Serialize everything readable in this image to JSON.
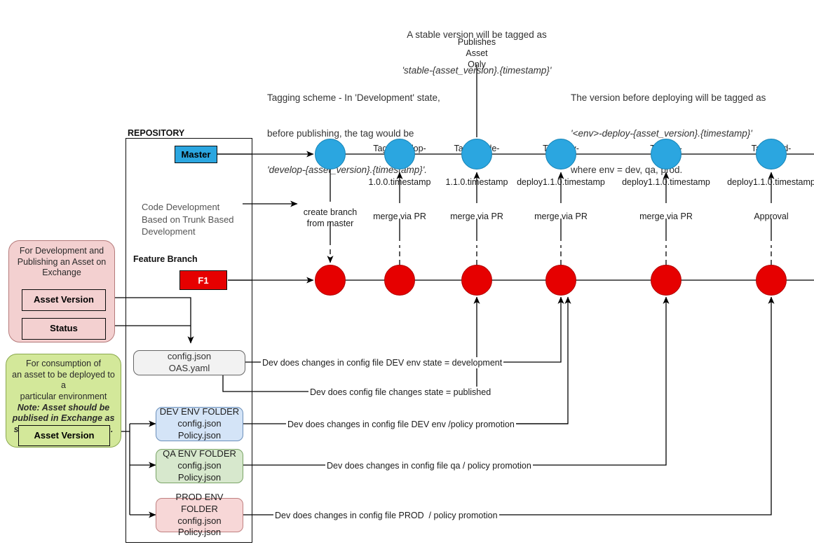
{
  "diagram": {
    "title_repository": "REPOSITORY",
    "annotations": {
      "stable_version_line1": "A stable version will be tagged as",
      "stable_version_line2": "'stable-{asset_version}.{timestamp}'",
      "publishes_asset_only": "Publishes\nAsset\nOnly",
      "tagging_scheme_line1": "Tagging scheme - In 'Development' state,",
      "tagging_scheme_line2": "before publishing, the tag would be",
      "tagging_scheme_line3": "'develop-{asset_version}.{timestamp}'.",
      "deploy_tag_line1": "The version before deploying will be tagged as",
      "deploy_tag_line2": "'<env>-deploy-{asset_version}.{timestamp}'",
      "deploy_tag_line3": "where env = dev, qa, prod."
    },
    "tags": [
      {
        "line1": "Tag=develop-",
        "line2": "1.0.0.timestamp"
      },
      {
        "line1": "Tag=stable-",
        "line2": "1.1.0.timestamp"
      },
      {
        "line1": "Tag=dev-",
        "line2": "deploy1.1.0.timestamp"
      },
      {
        "line1": "Tag=qa-",
        "line2": "deploy1.1.0.timestamp"
      },
      {
        "line1": "Tag=prod-",
        "line2": "deploy1.1.0.timestamp"
      }
    ],
    "branches": {
      "master_label": "Master",
      "feature_branch_label": "Feature Branch",
      "feature_node_label": "F1",
      "code_development_note": "Code Development\nBased on Trunk Based\nDevelopment"
    },
    "edge_labels": {
      "create_branch": "create branch\nfrom master",
      "merge_via_pr_1": "merge via PR",
      "merge_via_pr_2": "merge via PR",
      "merge_via_pr_3": "merge via PR",
      "merge_via_pr_4": "merge via PR",
      "approval": "Approval"
    },
    "flow_labels": {
      "dev_env_state_development": "Dev does changes in config file DEV env state = development",
      "config_state_published": "Dev does config file changes state = published",
      "dev_policy_promotion": "Dev does changes in config file DEV env /policy promotion",
      "qa_policy_promotion": "Dev does changes in config file qa / policy promotion",
      "prod_policy_promotion": "Dev does changes in config file PROD  / policy promotion"
    },
    "callouts": {
      "development": {
        "header": "For Development and\nPublishing an Asset on\nExchange",
        "asset_version": "Asset Version",
        "status": "Status",
        "color": "#f3d0d0"
      },
      "consumption": {
        "header_line1": "For consumption of",
        "header_line2": "an asset to be deployed to a",
        "header_line3": "particular environment",
        "note_line1": "Note: Asset should be",
        "note_line2": "publised in Exchange as",
        "note_line3": "stable for consumption.",
        "asset_version": "Asset Version",
        "color": "#d3e89a"
      }
    },
    "files": {
      "config_oas": "config.json\nOAS.yaml",
      "dev_env_folder": "DEV ENV FOLDER\nconfig.json\nPolicy.json",
      "qa_env_folder": "QA ENV FOLDER\nconfig.json\nPolicy.json",
      "prod_env_folder": "PROD ENV FOLDER\nconfig.json\nPolicy.json"
    },
    "colors": {
      "master_node": "#2ba6e0",
      "feature_node": "#e60000",
      "dev_folder": "#d4e4f7",
      "qa_folder": "#d7e8cd",
      "prod_folder": "#f7d7d7"
    }
  }
}
